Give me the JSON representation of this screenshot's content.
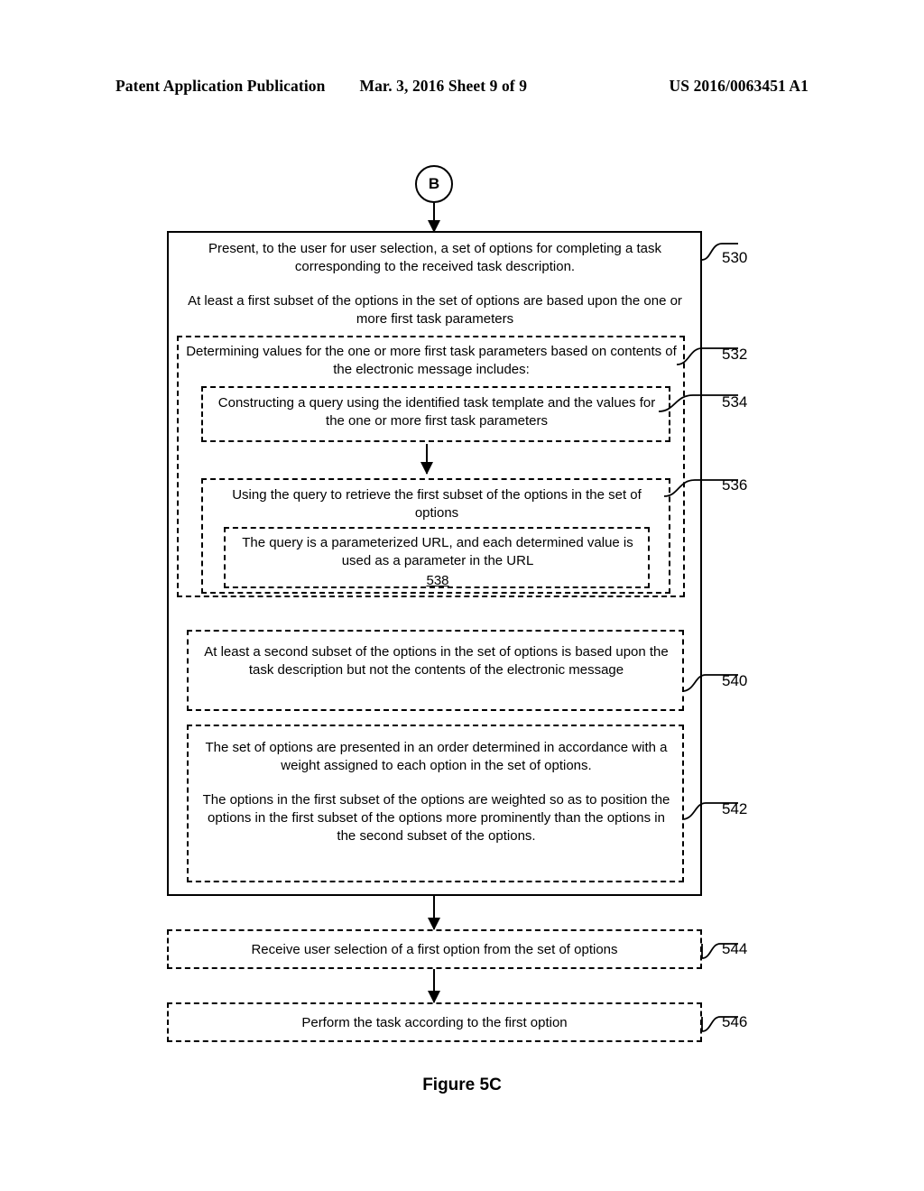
{
  "header": {
    "left": "Patent Application Publication",
    "middle": "Mar. 3, 2016  Sheet 9 of 9",
    "right": "US 2016/0063451 A1"
  },
  "connector": {
    "label": "B"
  },
  "figure": {
    "caption": "Figure 5C"
  },
  "boxes": {
    "b530": {
      "ref": "530",
      "para1": "Present, to the user for user selection, a set of options for completing a task corresponding to the received task description.",
      "para2": "At least a first subset of the options in the set of options are based upon the one or more first task parameters"
    },
    "b532": {
      "ref": "532",
      "text": "Determining values for the one or more first task parameters based on contents of the electronic message includes:"
    },
    "b534": {
      "ref": "534",
      "text": "Constructing a query using the identified task template and the values for the one or more first task parameters"
    },
    "b536": {
      "ref": "536",
      "text": "Using the query to retrieve the first subset of the options in the set of options"
    },
    "b538": {
      "ref": "538",
      "text": "The query is a parameterized URL, and each determined value is used as a parameter in the URL"
    },
    "b540": {
      "ref": "540",
      "text": "At least a second subset of the options in the set of options is based upon the task description but not the contents of the electronic message"
    },
    "b542": {
      "ref": "542",
      "para1": "The set of options are presented in an order determined in accordance with a weight assigned to each option in the set of options.",
      "para2": "The options in the first subset of the options are weighted so as to position the options in the first subset of the options more prominently than the options in the second subset of the options."
    },
    "b544": {
      "ref": "544",
      "text": "Receive user selection of a first option from the set of options"
    },
    "b546": {
      "ref": "546",
      "text": "Perform the task according to the first option"
    }
  }
}
